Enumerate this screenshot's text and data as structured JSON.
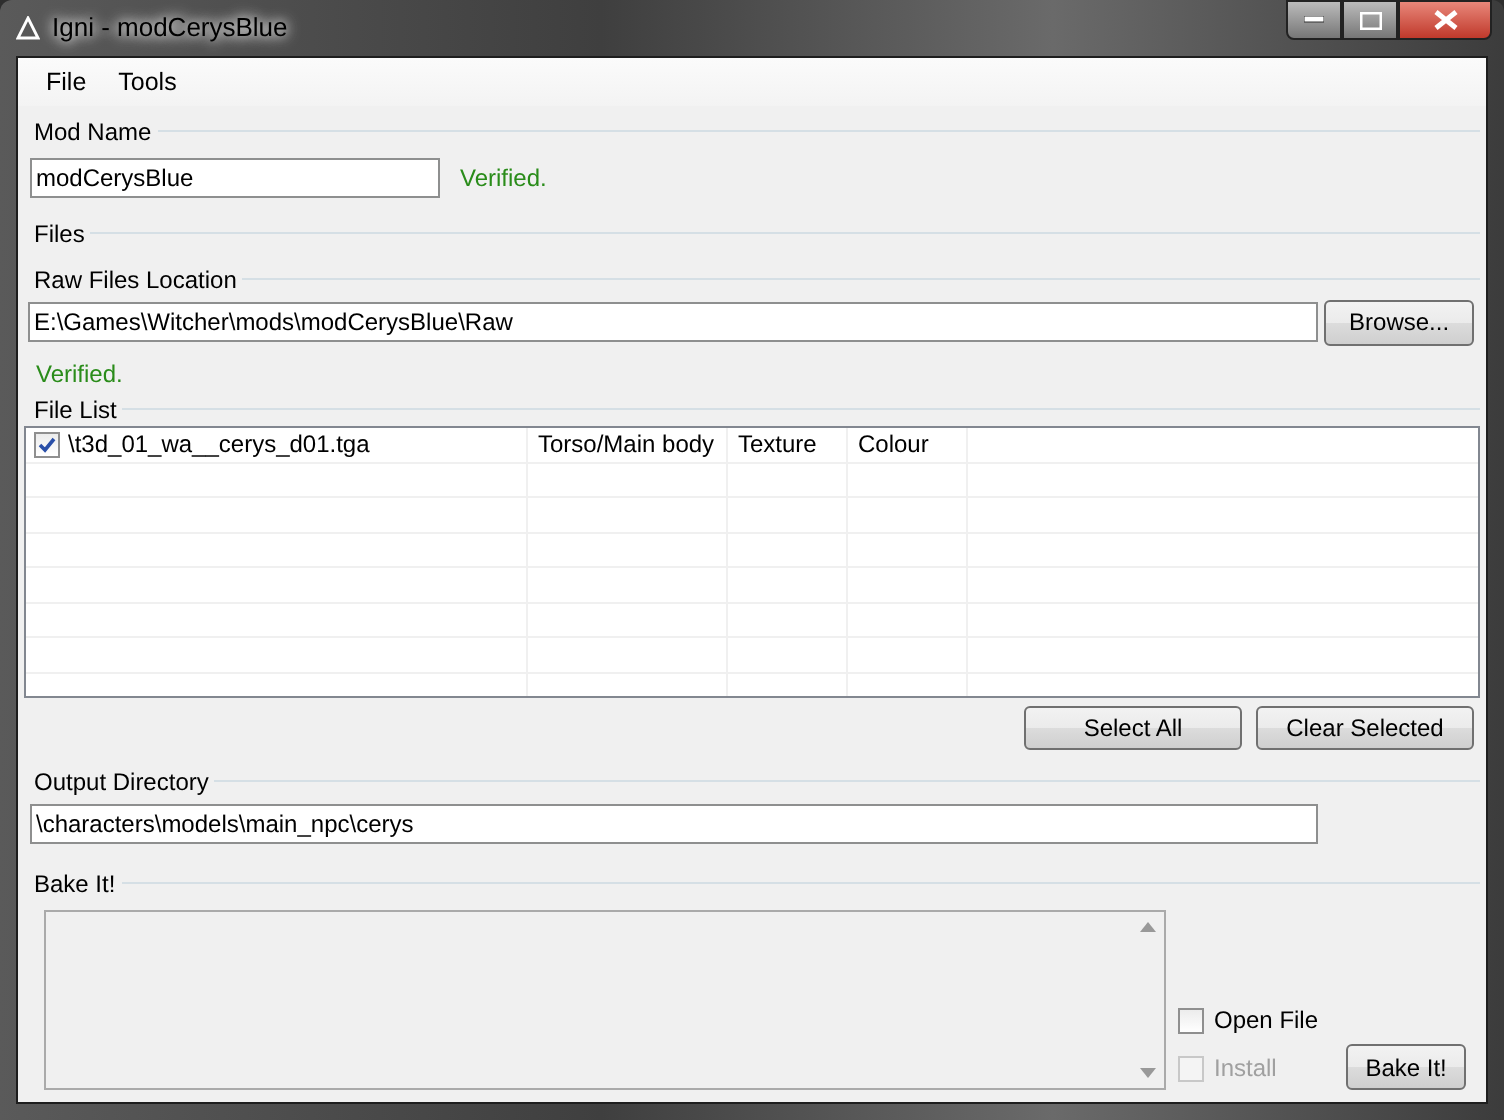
{
  "window": {
    "title": "Igni - modCerysBlue"
  },
  "menu": [
    {
      "label": "File"
    },
    {
      "label": "Tools"
    }
  ],
  "mod_name": {
    "label": "Mod Name",
    "value": "modCerysBlue",
    "status": "Verified."
  },
  "files": {
    "label": "Files",
    "location_label": "Raw Files Location",
    "location": "E:\\Games\\Witcher\\mods\\modCerysBlue\\Raw",
    "browse": "Browse...",
    "status": "Verified."
  },
  "file_list": {
    "label": "File List",
    "rows": [
      {
        "checked": true,
        "cells": [
          "\\t3d_01_wa__cerys_d01.tga",
          "Torso/Main body",
          "Texture",
          "Colour"
        ]
      }
    ],
    "buttons": [
      "Select All",
      "Clear Selected"
    ]
  },
  "output": {
    "label": "Output Directory",
    "value": "\\characters\\models\\main_npc\\cerys"
  },
  "bake": {
    "label": "Bake It!",
    "options": [
      {
        "label": "Open File",
        "checked": false,
        "disabled": false
      },
      {
        "label": "Install",
        "checked": false,
        "disabled": true
      }
    ],
    "button": "Bake It!"
  }
}
